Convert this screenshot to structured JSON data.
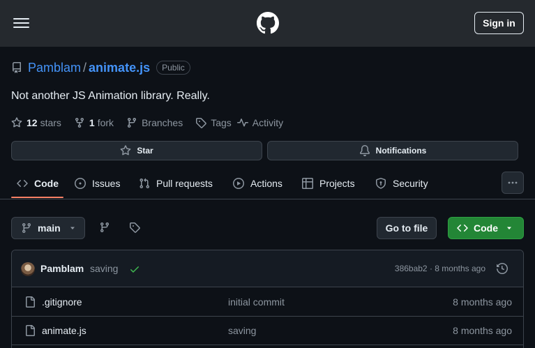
{
  "header": {
    "signin_label": "Sign in",
    "menu_icon": "hamburger-icon",
    "logo_icon": "github-logo"
  },
  "repo": {
    "owner": "Pamblam",
    "separator": "/",
    "name": "animate.js",
    "visibility": "Public",
    "description": "Not another JS Animation library. Really."
  },
  "meta": {
    "stars_count": "12",
    "stars_label": "stars",
    "forks_count": "1",
    "forks_label": "fork",
    "branches_label": "Branches",
    "tags_label": "Tags",
    "activity_label": "Activity"
  },
  "actions": {
    "star_label": "Star",
    "notifications_label": "Notifications"
  },
  "tabs": [
    {
      "label": "Code",
      "icon": "code-icon"
    },
    {
      "label": "Issues",
      "icon": "issue-icon"
    },
    {
      "label": "Pull requests",
      "icon": "pull-request-icon"
    },
    {
      "label": "Actions",
      "icon": "play-icon"
    },
    {
      "label": "Projects",
      "icon": "table-icon"
    },
    {
      "label": "Security",
      "icon": "shield-icon"
    }
  ],
  "toolbar": {
    "branch": "main",
    "goto_file_label": "Go to file",
    "code_label": "Code"
  },
  "latest_commit": {
    "author": "Pamblam",
    "message": "saving",
    "hash_and_date": "386bab2 · 8 months ago"
  },
  "files": [
    {
      "name": ".gitignore",
      "message": "initial commit",
      "date": "8 months ago"
    },
    {
      "name": "animate.js",
      "message": "saving",
      "date": "8 months ago"
    }
  ],
  "colors": {
    "accent_link": "#4493f8",
    "tab_underline": "#f78166",
    "primary_button": "#238636",
    "success_check": "#3fb950"
  }
}
